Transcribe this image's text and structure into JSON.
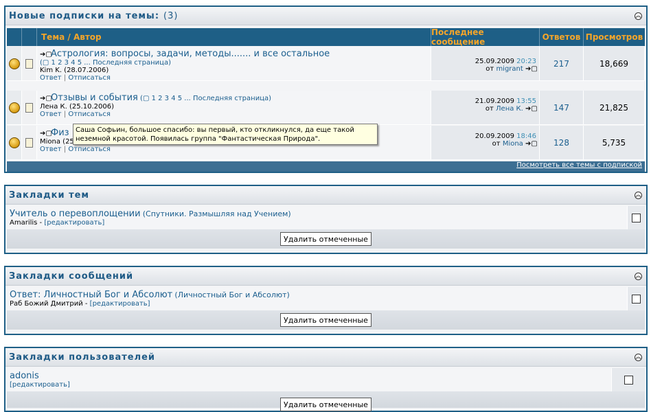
{
  "subs": {
    "title": "Новые подписки на темы:",
    "count": "(3)",
    "headers": {
      "topic": "Тема / Автор",
      "last": "Последнее сообщение",
      "replies": "Ответов",
      "views": "Просмотров"
    },
    "rows": [
      {
        "title": "Астрология: вопросы, задачи, методы....... и все остальное",
        "pages_open": "(",
        "pages": "1 2 3 4 5 ... Последняя страница",
        "pages_close": ")",
        "author": "Kim K. (28.07.2006)",
        "reply": "Ответ",
        "unsub": "Отписаться",
        "date": "25.09.2009",
        "time": "20:23",
        "from": "от",
        "user": "migrant",
        "replies": "217",
        "views": "18,669"
      },
      {
        "title": "Отзывы и события",
        "pages_open": "(",
        "pages": "1 2 3 4 5 ... Последняя страница",
        "pages_close": ")",
        "author": "Лена К. (25.10.2006)",
        "reply": "Ответ",
        "unsub": "Отписаться",
        "date": "21.09.2009",
        "time": "13:55",
        "from": "от",
        "user": "Лена К.",
        "replies": "147",
        "views": "21,825"
      },
      {
        "title": "Физ",
        "author": "Miona (25.",
        "reply": "Ответ",
        "unsub": "Отписаться",
        "date": "20.09.2009",
        "time": "18:46",
        "from": "от",
        "user": "Miona",
        "replies": "128",
        "views": "5,735"
      }
    ],
    "footer": "Посмотреть все темы с подпиской"
  },
  "tooltip": "Саша Софьин, большое спасибо: вы первый, кто откликнулся, да еще такой неземной красотой. Появилась группа \"Фантастическая Природа\".",
  "bm_topics": {
    "title": "Закладки тем",
    "item_title": "Учитель о перевоплощении",
    "item_forum": "(Спутники. Размышляя над Учением)",
    "by": "Amarilis -",
    "edit": "[редактировать]",
    "button": "Удалить отмеченные"
  },
  "bm_posts": {
    "title": "Закладки сообщений",
    "item_title": "Ответ: Личностный Бог и Абсолют",
    "item_forum": "(Личностный Бог и Абсолют)",
    "by": "Раб Божий Дмитрий -",
    "edit": "[редактировать]",
    "button": "Удалить отмеченные"
  },
  "bm_users": {
    "title": "Закладки пользователей",
    "item_title": "adonis",
    "edit": "[редактировать]",
    "button": "Удалить отмеченные"
  }
}
